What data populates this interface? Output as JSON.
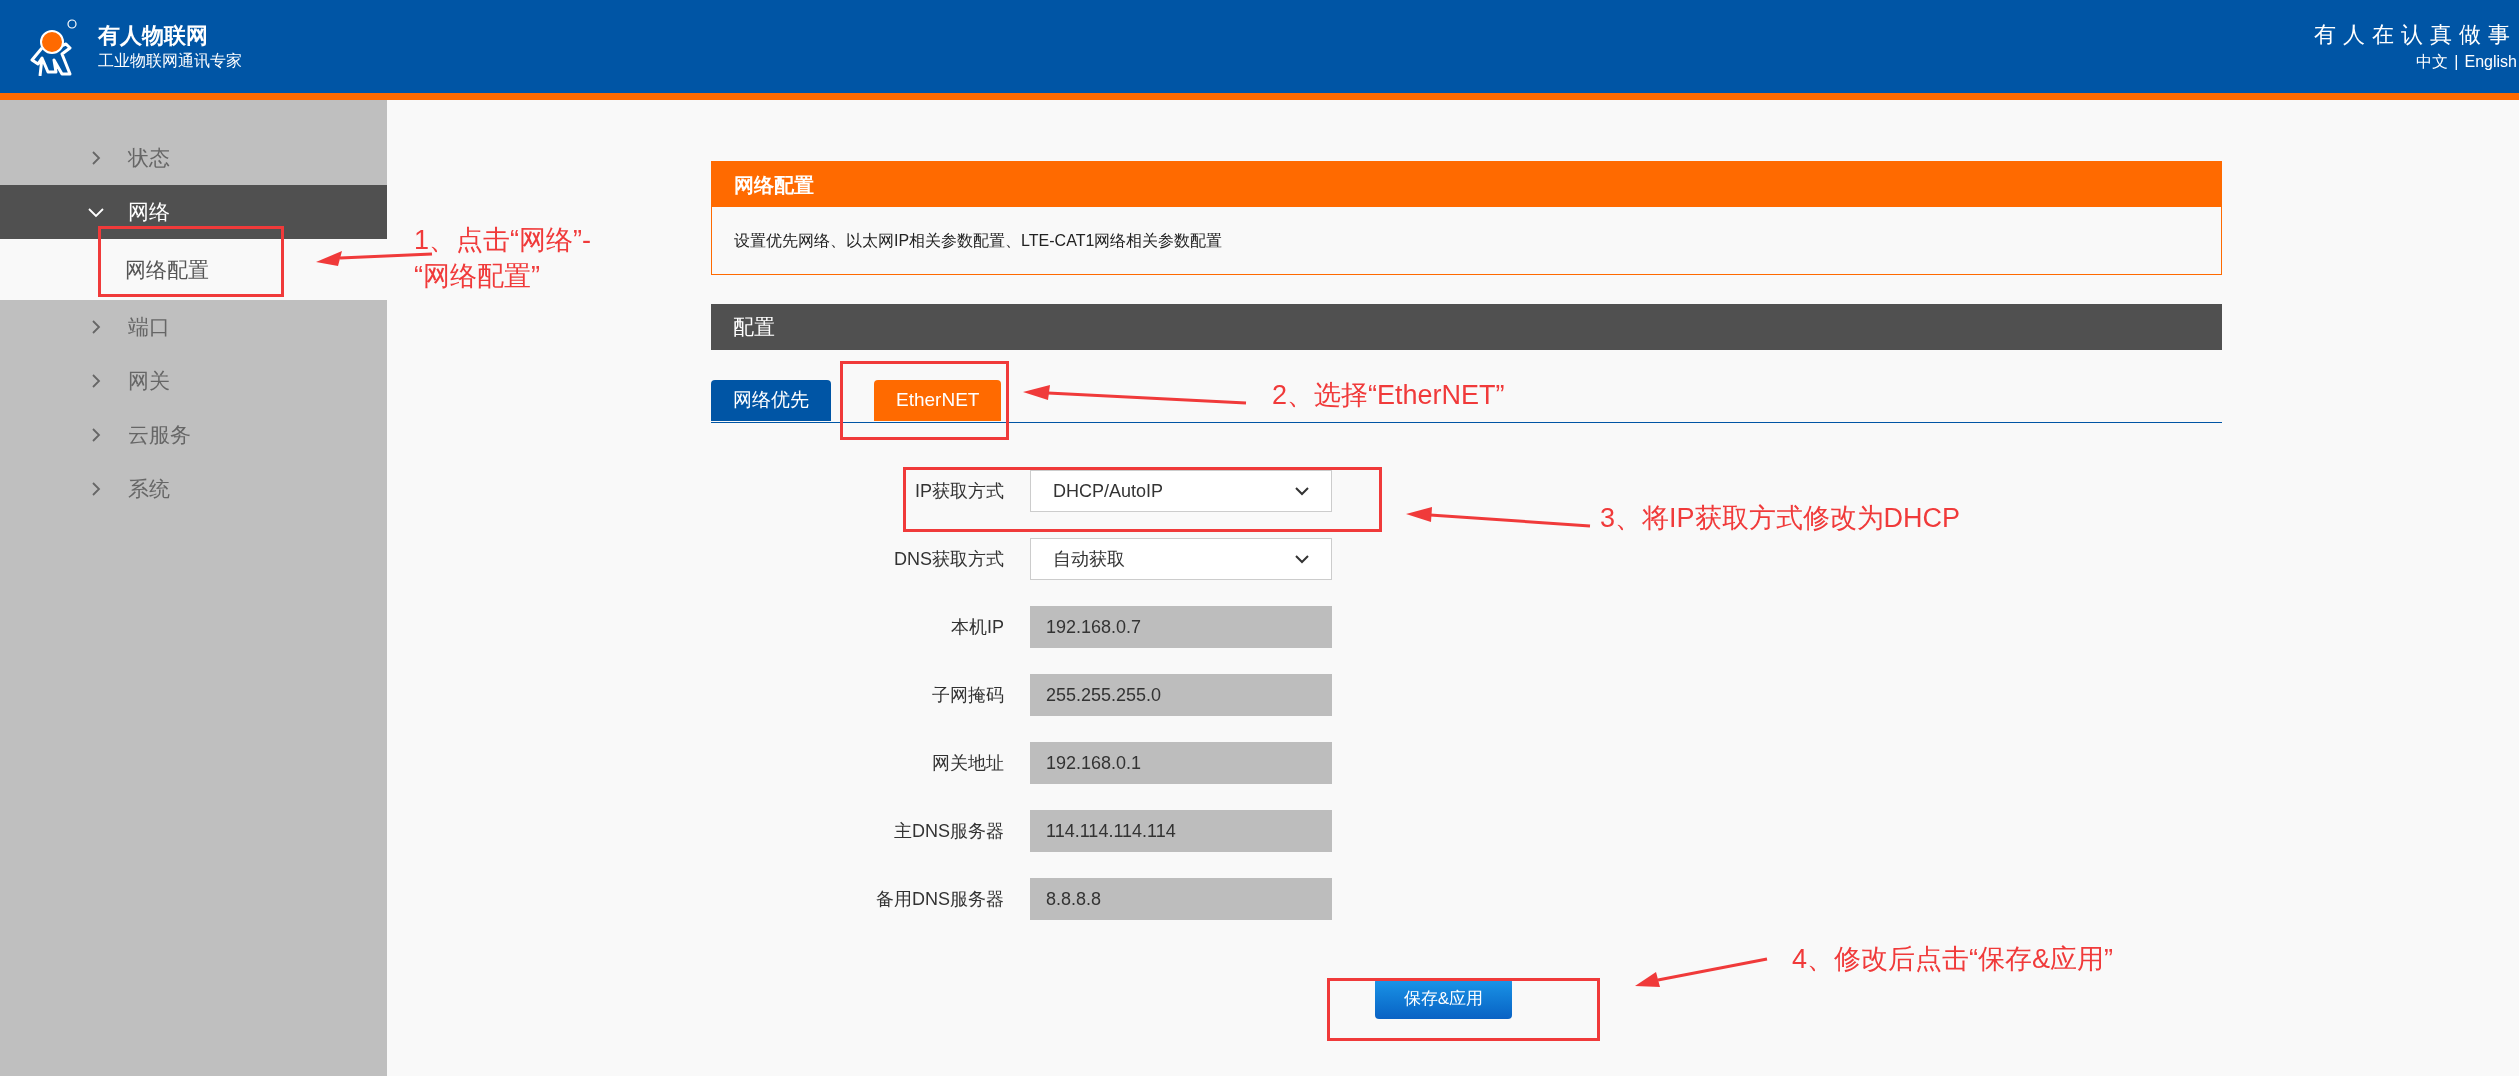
{
  "header": {
    "brand": "有人物联网",
    "tagline": "工业物联网通讯专家",
    "slogan": "有人在认真做事",
    "languages": [
      "中文",
      "English"
    ],
    "separator": "|"
  },
  "sidebar": {
    "items": [
      {
        "label": "状态",
        "expanded": false
      },
      {
        "label": "网络",
        "expanded": true,
        "children": [
          {
            "label": "网络配置",
            "selected": true
          }
        ]
      },
      {
        "label": "端口",
        "expanded": false
      },
      {
        "label": "网关",
        "expanded": false
      },
      {
        "label": "云服务",
        "expanded": false
      },
      {
        "label": "系统",
        "expanded": false
      }
    ]
  },
  "info_panel": {
    "title": "网络配置",
    "description": "设置优先网络、以太网IP相关参数配置、LTE-CAT1网络相关参数配置"
  },
  "config_bar": {
    "title": "配置"
  },
  "tabs": [
    {
      "label": "网络优先",
      "selected": false
    },
    {
      "label": "EtherNET",
      "selected": true
    }
  ],
  "form": [
    {
      "label": "IP获取方式",
      "kind": "select",
      "value": "DHCP/AutoIP"
    },
    {
      "label": "DNS获取方式",
      "kind": "select",
      "value": "自动获取"
    },
    {
      "label": "本机IP",
      "kind": "readonly",
      "value": "192.168.0.7"
    },
    {
      "label": "子网掩码",
      "kind": "readonly",
      "value": "255.255.255.0"
    },
    {
      "label": "网关地址",
      "kind": "readonly",
      "value": "192.168.0.1"
    },
    {
      "label": "主DNS服务器",
      "kind": "readonly",
      "value": "114.114.114.114"
    },
    {
      "label": "备用DNS服务器",
      "kind": "readonly",
      "value": "8.8.8.8"
    }
  ],
  "save_button": "保存&应用",
  "annotations": [
    {
      "text": "1、点击“网络”-\n“网络配置”"
    },
    {
      "text": "2、选择“EtherNET”"
    },
    {
      "text": "3、将IP获取方式修改为DHCP"
    },
    {
      "text": "4、修改后点击“保存&应用”"
    }
  ]
}
